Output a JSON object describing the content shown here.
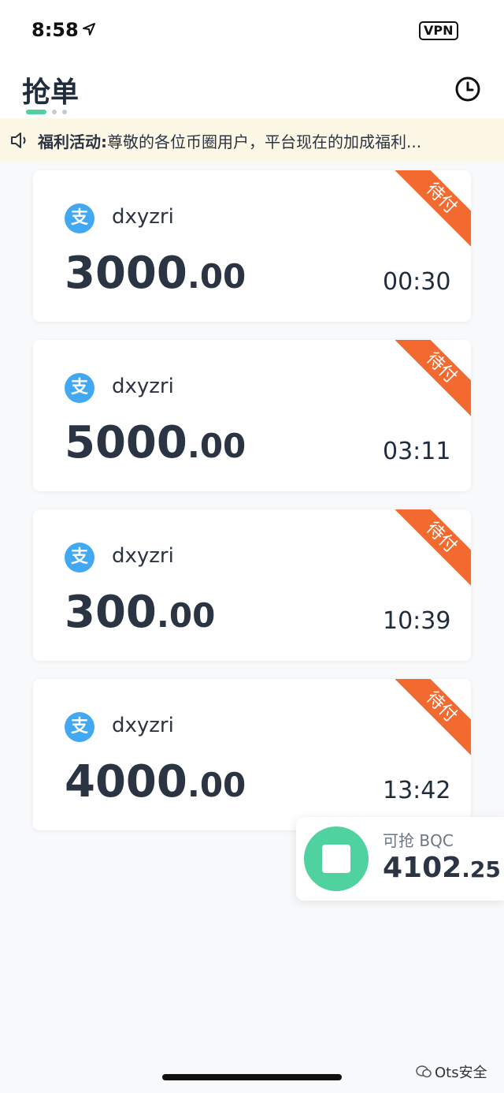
{
  "status_bar": {
    "time": "8:58",
    "vpn": "VPN"
  },
  "header": {
    "title": "抢单"
  },
  "notice": {
    "label": "福利活动:",
    "text": "尊敬的各位币圈用户，平台现在的加成福利..."
  },
  "orders": [
    {
      "payment_icon": "支",
      "user": "dxyzri",
      "amount_int": "3000",
      "amount_dec": ".00",
      "timer": "00:30",
      "status": "待付"
    },
    {
      "payment_icon": "支",
      "user": "dxyzri",
      "amount_int": "5000",
      "amount_dec": ".00",
      "timer": "03:11",
      "status": "待付"
    },
    {
      "payment_icon": "支",
      "user": "dxyzri",
      "amount_int": "300",
      "amount_dec": ".00",
      "timer": "10:39",
      "status": "待付"
    },
    {
      "payment_icon": "支",
      "user": "dxyzri",
      "amount_int": "4000",
      "amount_dec": ".00",
      "timer": "13:42",
      "status": "待付"
    }
  ],
  "floating_panel": {
    "label": "可抢 BQC",
    "value_int": "4102",
    "value_dec": ".25"
  },
  "watermark": {
    "text": "Ots安全"
  },
  "colors": {
    "accent": "#4fd1a0",
    "ribbon": "#f26a2f",
    "pay_icon": "#41a8f1",
    "notice_bg": "#fdf8e6"
  }
}
